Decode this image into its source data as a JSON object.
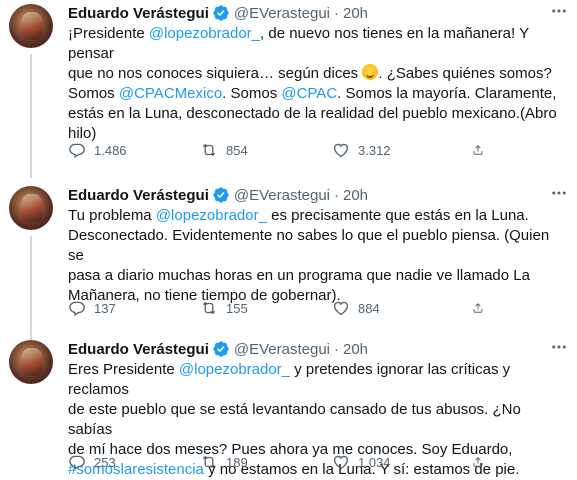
{
  "tweets": [
    {
      "name": "Eduardo Verástegui",
      "handle": "@EVerastegui",
      "separator": "·",
      "time": "20h",
      "body_parts": [
        {
          "t": "¡Presidente "
        },
        {
          "t": "@lopezobrador_",
          "link": true
        },
        {
          "t": ", de nuevo nos tienes en la mañanera! Y pensar\nque no nos conoces siquiera… según dices "
        },
        {
          "emoji": "sweat-smile"
        },
        {
          "t": ". ¿Sabes quiénes somos?\nSomos "
        },
        {
          "t": "@CPACMexico",
          "link": true
        },
        {
          "t": ". Somos "
        },
        {
          "t": "@CPAC",
          "link": true
        },
        {
          "t": ". Somos la mayoría. Claramente,\nestás en la Luna, desconectado de la realidad del pueblo mexicano.(Abro\nhilo)"
        }
      ],
      "replies": "1.486",
      "retweets": "854",
      "likes": "3.312"
    },
    {
      "name": "Eduardo Verástegui",
      "handle": "@EVerastegui",
      "separator": "·",
      "time": "20h",
      "body_parts": [
        {
          "t": "Tu problema "
        },
        {
          "t": "@lopezobrador_",
          "link": true
        },
        {
          "t": " es precisamente que estás en la Luna.\nDesconectado. Evidentemente no sabes lo que el pueblo piensa. (Quien se\npasa a diario muchas horas en un programa que nadie ve llamado La\nMañanera, no tiene tiempo de gobernar)."
        }
      ],
      "replies": "137",
      "retweets": "155",
      "likes": "884"
    },
    {
      "name": "Eduardo Verástegui",
      "handle": "@EVerastegui",
      "separator": "·",
      "time": "20h",
      "body_parts": [
        {
          "t": "Eres Presidente "
        },
        {
          "t": "@lopezobrador_",
          "link": true
        },
        {
          "t": " y pretendes ignorar las críticas y reclamos\nde este pueblo que se está levantando cansado de tus abusos. ¿No sabías\nde mí hace dos meses? Pues ahora ya me conoces. Soy Eduardo,\n"
        },
        {
          "t": "#somoslaresistencia",
          "link": true
        },
        {
          "t": " y no estamos en la Luna. Y sí: estamos de pie."
        }
      ],
      "replies": "253",
      "retweets": "189",
      "likes": "1.034"
    }
  ],
  "icons": {
    "more": "more-icon",
    "verified": "verified-badge-icon",
    "reply": "reply-icon",
    "retweet": "retweet-icon",
    "like": "heart-icon",
    "share": "share-icon",
    "emoji": "sweat-smile-emoji"
  },
  "colors": {
    "link": "#1d9bf0",
    "text": "#0f1419",
    "secondary": "#536471",
    "thread_line": "#cfd9de",
    "verified": "#1d9bf0"
  }
}
